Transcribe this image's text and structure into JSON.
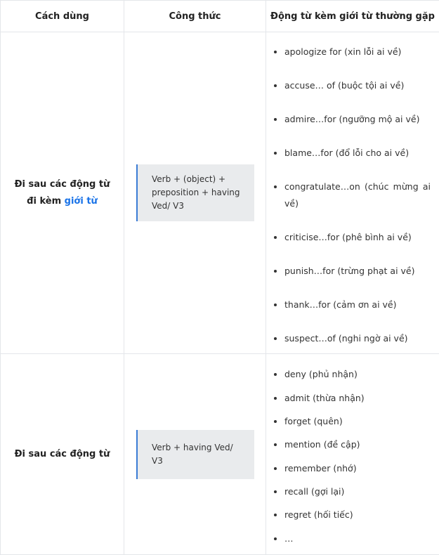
{
  "table": {
    "headers": [
      "Cách dùng",
      "Công thức",
      "Động từ kèm giới từ thường gặp"
    ],
    "rows": [
      {
        "usage_text": "Đi sau các động từ đi kèm",
        "usage_link": "giới từ",
        "formula": "Verb + (object) + preposition + having Ved/ V3",
        "verbs": [
          "apologize for (xin lỗi ai về)",
          "accuse… of (buộc tội ai về)",
          "admire…for (ngưỡng mộ ai về)",
          "blame…for (đổ lỗi cho ai về)",
          "congratulate…on (chúc mừng ai về)",
          "criticise…for (phê bình ai về)",
          "punish…for (trừng phạt ai về)",
          "thank…for (cảm ơn ai về)",
          "suspect…of (nghi ngờ ai về)"
        ]
      },
      {
        "usage_text": "Đi sau các động từ",
        "formula": "Verb + having Ved/ V3",
        "verbs": [
          "deny (phủ nhận)",
          "admit (thừa nhận)",
          "forget (quên)",
          "mention (đề cập)",
          "remember (nhớ)",
          "recall (gợi lại)",
          "regret (hối tiếc)",
          "…"
        ]
      }
    ]
  }
}
